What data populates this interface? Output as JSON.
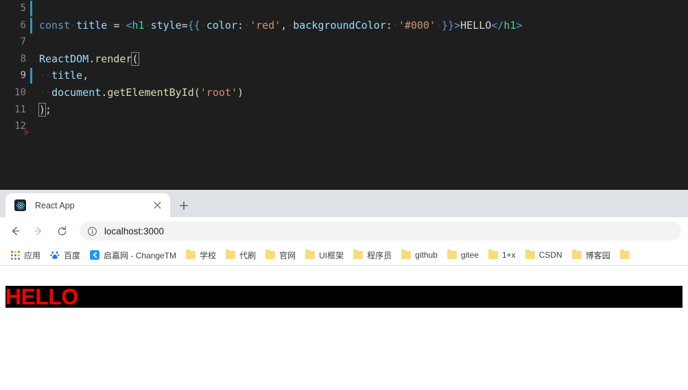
{
  "editor": {
    "name": "vscode-editor",
    "background": "#1e1e1e",
    "lines": [
      {
        "num": "5",
        "active": false,
        "cursorbar": true,
        "tokens": []
      },
      {
        "num": "6",
        "active": false,
        "cursorbar": true,
        "tokens": [
          {
            "t": "const",
            "c": "t-kw"
          },
          {
            "t": "·",
            "c": "dot"
          },
          {
            "t": "title",
            "c": "t-var"
          },
          {
            "t": "·",
            "c": "dot"
          },
          {
            "t": "=",
            "c": "t-white"
          },
          {
            "t": "·",
            "c": "dot"
          },
          {
            "t": "<",
            "c": "t-brace"
          },
          {
            "t": "h1",
            "c": "t-tag"
          },
          {
            "t": "·",
            "c": "dot"
          },
          {
            "t": "style",
            "c": "t-attr"
          },
          {
            "t": "=",
            "c": "t-white"
          },
          {
            "t": "{{",
            "c": "t-brace"
          },
          {
            "t": "·",
            "c": "dot"
          },
          {
            "t": "color",
            "c": "t-var"
          },
          {
            "t": ":",
            "c": "t-white"
          },
          {
            "t": "·",
            "c": "dot"
          },
          {
            "t": "'red'",
            "c": "t-str"
          },
          {
            "t": ",",
            "c": "t-white"
          },
          {
            "t": "·",
            "c": "dot"
          },
          {
            "t": "backgroundColor",
            "c": "t-var"
          },
          {
            "t": ":",
            "c": "t-white"
          },
          {
            "t": "·",
            "c": "dot"
          },
          {
            "t": "'#000'",
            "c": "t-str"
          },
          {
            "t": "·",
            "c": "dot"
          },
          {
            "t": "}}",
            "c": "t-brace"
          },
          {
            "t": ">",
            "c": "t-brace"
          },
          {
            "t": "HELLO",
            "c": "t-white"
          },
          {
            "t": "</",
            "c": "t-brace"
          },
          {
            "t": "h1",
            "c": "t-tag"
          },
          {
            "t": ">",
            "c": "t-brace"
          }
        ]
      },
      {
        "num": "7",
        "active": false,
        "cursorbar": false,
        "tokens": []
      },
      {
        "num": "8",
        "active": false,
        "cursorbar": false,
        "tokens": [
          {
            "t": "ReactDOM",
            "c": "t-obj"
          },
          {
            "t": ".",
            "c": "t-white"
          },
          {
            "t": "render",
            "c": "t-fn"
          },
          {
            "t": "(",
            "c": "t-white bracket-box"
          }
        ]
      },
      {
        "num": "9",
        "active": true,
        "cursorbar": true,
        "tokens": [
          {
            "t": "··",
            "c": "dot"
          },
          {
            "t": "title",
            "c": "t-var"
          },
          {
            "t": ",",
            "c": "t-white"
          }
        ]
      },
      {
        "num": "10",
        "active": false,
        "cursorbar": false,
        "tokens": [
          {
            "t": "··",
            "c": "dot"
          },
          {
            "t": "document",
            "c": "t-obj"
          },
          {
            "t": ".",
            "c": "t-white"
          },
          {
            "t": "getElementById",
            "c": "t-fn"
          },
          {
            "t": "(",
            "c": "t-white"
          },
          {
            "t": "'root'",
            "c": "t-str"
          },
          {
            "t": ")",
            "c": "t-white"
          }
        ]
      },
      {
        "num": "11",
        "active": false,
        "cursorbar": false,
        "tokens": [
          {
            "t": ")",
            "c": "t-white bracket-box"
          },
          {
            "t": ";",
            "c": "t-white"
          }
        ]
      },
      {
        "num": "12",
        "active": false,
        "cursorbar": false,
        "tokens": []
      }
    ]
  },
  "browser": {
    "tab": {
      "title": "React App",
      "favicon_name": "react-logo-icon",
      "close_label": "×"
    },
    "newtab_label": "+",
    "nav": {
      "back_label": "←",
      "forward_label": "→",
      "reload_label": "↻"
    },
    "omnibox": {
      "site_info_icon": "info-circle-icon",
      "url": "localhost:3000"
    },
    "bookmarks": [
      {
        "label": "应用",
        "icon": "apps-grid-icon"
      },
      {
        "label": "百度",
        "icon": "baidu-icon"
      },
      {
        "label": "启嘉网 - ChangeTM",
        "icon": "changetm-icon"
      },
      {
        "label": "学校",
        "icon": "folder-icon"
      },
      {
        "label": "代刷",
        "icon": "folder-icon"
      },
      {
        "label": "官网",
        "icon": "folder-icon"
      },
      {
        "label": "UI框架",
        "icon": "folder-icon"
      },
      {
        "label": "程序员",
        "icon": "folder-icon"
      },
      {
        "label": "github",
        "icon": "folder-icon"
      },
      {
        "label": "gitee",
        "icon": "folder-icon"
      },
      {
        "label": "1+x",
        "icon": "folder-icon"
      },
      {
        "label": "CSDN",
        "icon": "folder-icon"
      },
      {
        "label": "博客园",
        "icon": "folder-icon"
      },
      {
        "label": "",
        "icon": "folder-icon"
      }
    ]
  },
  "page": {
    "heading": "HELLO",
    "heading_color": "#ff0000",
    "heading_background": "#000000"
  }
}
